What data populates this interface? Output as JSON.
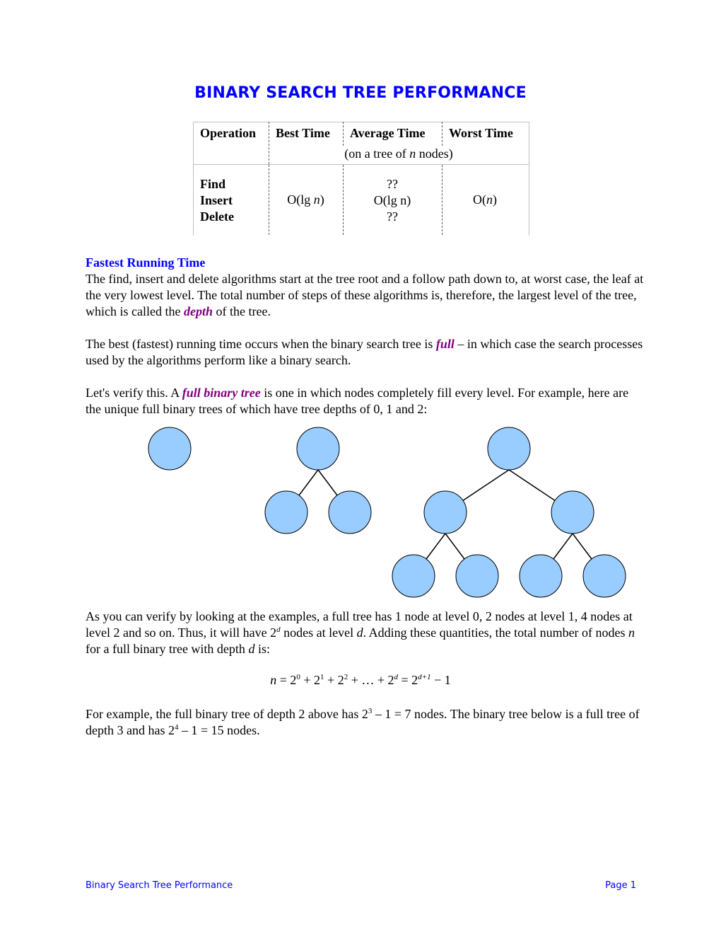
{
  "title": "BINARY SEARCH TREE PERFORMANCE",
  "table": {
    "headers": [
      "Operation",
      "Best Time",
      "Average Time",
      "Worst Time"
    ],
    "subheader": {
      "prefix": "(on a tree of ",
      "var": "n",
      "suffix": " nodes)"
    },
    "operations": [
      "Find",
      "Insert",
      "Delete"
    ],
    "best": {
      "prefix": "O(lg ",
      "var": "n",
      "suffix": ")"
    },
    "average": [
      "??",
      "O(lg n)",
      "??"
    ],
    "worst": {
      "prefix": "O(",
      "var": "n",
      "suffix": ")"
    }
  },
  "section": {
    "heading": "Fastest Running Time",
    "p1": {
      "before": "The find, insert and delete algorithms start at the tree root and a follow path down to, at worst case, the leaf at the very lowest level. The total number of steps of these algorithms is, therefore, the largest level of the tree, which is called the ",
      "term": "depth",
      "after": " of the tree."
    },
    "p2": {
      "before": "The best (fastest) running time occurs when the binary search tree is ",
      "term": "full",
      "after": " – in which case the search processes used by the algorithms perform like a binary search."
    },
    "p3": {
      "before": "Let's verify this. A ",
      "term": "full binary tree",
      "after": " is one in which nodes completely fill every level. For example, here are the unique full binary trees of which have tree depths of 0, 1 and 2:"
    },
    "p4": {
      "a": "As you can verify by looking at the examples, a full tree has 1 node at level 0, 2 nodes at level 1, 4 nodes at level 2 and so on. Thus, it will have 2",
      "sup": "d",
      "b": " nodes at level ",
      "var_d": "d",
      "c": ". Adding these quantities, the total number of nodes ",
      "var_n": "n",
      "d": " for a full binary tree with depth ",
      "var_d2": "d",
      "e": " is:"
    },
    "formula": {
      "lhs": "n",
      "eq": " = 2",
      "s0": "0",
      "t1": " + 2",
      "s1": "1",
      "t2": " + 2",
      "s2": "2",
      "t3": " + … + 2",
      "sd": "d",
      "t4": " = 2",
      "sd1": "d+1",
      "t5": " − 1"
    },
    "p5": {
      "a": "For example, the full binary tree of depth 2 above has 2",
      "sup1": "3",
      "b": " – 1 = 7 nodes. The binary tree below is a full tree of depth 3 and has 2",
      "sup2": "4",
      "c": " – 1 = 15 nodes."
    }
  },
  "diagram": {
    "node_fill": "#99ccff",
    "node_stroke": "#000000",
    "trees": [
      {
        "depth": 0,
        "levels": [
          1
        ]
      },
      {
        "depth": 1,
        "levels": [
          1,
          2
        ]
      },
      {
        "depth": 2,
        "levels": [
          1,
          2,
          4
        ]
      }
    ]
  },
  "footer": {
    "left": "Binary Search Tree Performance",
    "right": "Page 1"
  }
}
